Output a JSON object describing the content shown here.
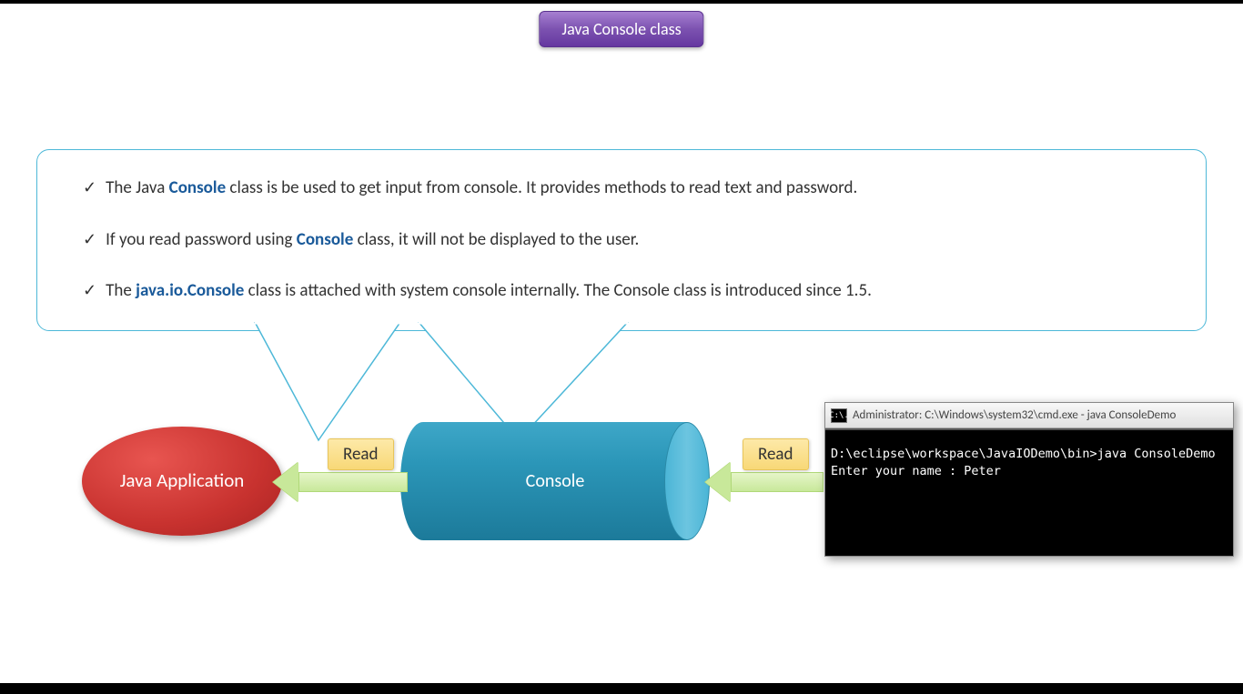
{
  "title": "Java Console class",
  "bullets": [
    {
      "pre": "The Java ",
      "bold": "Console",
      "post": " class is be used to get input from console. It provides methods to read text and password."
    },
    {
      "pre": "If you read password using ",
      "bold": "Console",
      "post": " class, it will not be displayed to the user."
    },
    {
      "pre": "The ",
      "bold": "java.io.Console",
      "post": " class is attached with system console internally. The Console class is introduced since 1.5."
    }
  ],
  "diagram": {
    "javaApp": "Java Application",
    "console": "Console",
    "readLabel1": "Read",
    "readLabel2": "Read"
  },
  "cmd": {
    "icon": "C:\\.",
    "title": "Administrator: C:\\Windows\\system32\\cmd.exe - java  ConsoleDemo",
    "line1": "D:\\eclipse\\workspace\\JavaIODemo\\bin>java ConsoleDemo",
    "line2": "Enter your name : Peter"
  }
}
